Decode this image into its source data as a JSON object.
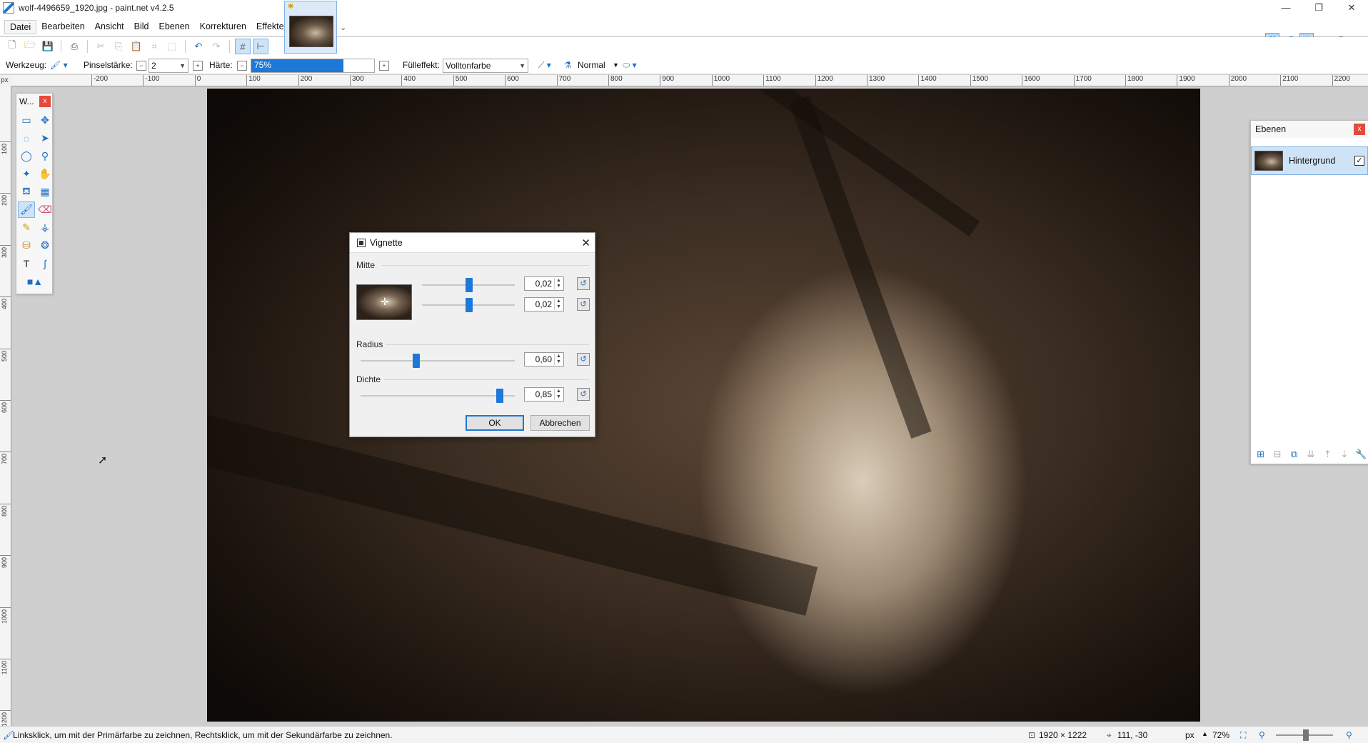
{
  "titlebar": {
    "title": "wolf-4496659_1920.jpg - paint.net v4.2.5",
    "min": "—",
    "restore": "❐",
    "close": "✕"
  },
  "menu": [
    "Datei",
    "Bearbeiten",
    "Ansicht",
    "Bild",
    "Ebenen",
    "Korrekturen",
    "Effekte"
  ],
  "options": {
    "tool_label": "Werkzeug:",
    "brush_label": "Pinselstärke:",
    "brush_value": "2",
    "hardness_label": "Härte:",
    "hardness_value": "75%",
    "hardness_fraction": 0.75,
    "fill_label": "Fülleffekt:",
    "fill_value": "Volltonfarbe",
    "blend_value": "Normal"
  },
  "ruler": {
    "unit": "px",
    "h_labels": [
      "-200",
      "-100",
      "0",
      "100",
      "200",
      "300",
      "400",
      "500",
      "600",
      "700",
      "800",
      "900",
      "1000",
      "1100",
      "1200",
      "1300",
      "1400",
      "1500",
      "1600",
      "1700",
      "1800",
      "1900",
      "2000",
      "2100",
      "2200"
    ],
    "v_labels": [
      "100",
      "200",
      "300",
      "400",
      "500",
      "600",
      "700",
      "800",
      "900",
      "1000",
      "1100",
      "1200"
    ]
  },
  "tools_window": {
    "title": "W...",
    "close": "x"
  },
  "layers_window": {
    "title": "Ebenen",
    "close": "x",
    "layer_name": "Hintergrund",
    "layer_checked": "✓"
  },
  "dialog": {
    "title": "Vignette",
    "center_label": "Mitte",
    "center_x": "0,02",
    "center_y": "0,02",
    "radius_label": "Radius",
    "radius_value": "0,60",
    "density_label": "Dichte",
    "density_value": "0,85",
    "ok": "OK",
    "cancel": "Abbrechen"
  },
  "status": {
    "hint": "Linksklick, um mit der Primärfarbe zu zeichnen, Rechtsklick, um mit der Sekundärfarbe zu zeichnen.",
    "image_size": "1920 × 1222",
    "cursor_pos": "111, -30",
    "unit": "px",
    "zoom": "72%"
  }
}
